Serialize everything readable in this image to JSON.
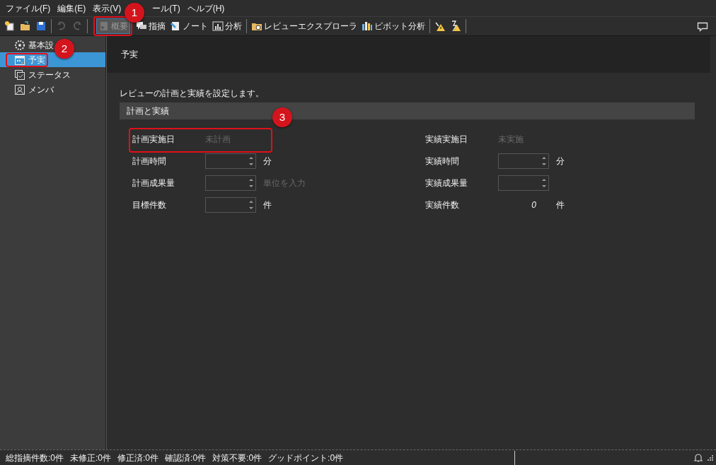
{
  "menu": [
    "ファイル(F)",
    "編集(E)",
    "表示(V)",
    "ール(T)",
    "ヘルプ(H)"
  ],
  "toolbar": [
    {
      "kind": "new",
      "disabled": false
    },
    {
      "kind": "open",
      "disabled": false
    },
    {
      "kind": "save",
      "disabled": false
    },
    {
      "kind": "sep"
    },
    {
      "kind": "undo",
      "disabled": true
    },
    {
      "kind": "redo",
      "disabled": true
    },
    {
      "kind": "sep"
    },
    {
      "kind": "overview",
      "label": "概要",
      "disabled": true
    },
    {
      "kind": "comment",
      "label": "指摘",
      "disabled": false
    },
    {
      "kind": "note",
      "label": "ノート",
      "disabled": false
    },
    {
      "kind": "chart",
      "label": "分析",
      "disabled": false
    },
    {
      "kind": "sep"
    },
    {
      "kind": "explorer",
      "label": "レビューエクスプローラ",
      "disabled": false
    },
    {
      "kind": "pivot",
      "label": "ピボット分析",
      "disabled": false
    },
    {
      "kind": "sep"
    },
    {
      "kind": "warn",
      "disabled": false
    },
    {
      "kind": "warn2",
      "disabled": false
    },
    {
      "kind": "sep"
    }
  ],
  "sidebar": {
    "items": [
      {
        "kind": "gear",
        "label": "基本設",
        "selected": false
      },
      {
        "kind": "calendar",
        "label": "予実",
        "selected": true
      },
      {
        "kind": "status",
        "label": "ステータス",
        "selected": false
      },
      {
        "kind": "member",
        "label": "メンバ",
        "selected": false
      }
    ]
  },
  "page_title": "予実",
  "description": "レビューの計画と実績を設定します。",
  "section": {
    "title": "計画と実績",
    "left": [
      {
        "kind": "text",
        "label": "計画実施日",
        "value": "未計画"
      },
      {
        "kind": "spin",
        "label": "計画時間",
        "unit": "分",
        "unit_dim": false
      },
      {
        "kind": "spin",
        "label": "計画成果量",
        "unit": "単位を入力",
        "unit_dim": true
      },
      {
        "kind": "spin",
        "label": "目標件数",
        "unit": "件",
        "unit_dim": false
      }
    ],
    "right": [
      {
        "kind": "text",
        "label": "実績実施日",
        "value": "未実施"
      },
      {
        "kind": "spin",
        "label": "実績時間",
        "unit": "分",
        "unit_dim": false
      },
      {
        "kind": "spin",
        "label": "実績成果量"
      },
      {
        "kind": "count",
        "label": "実績件数",
        "value": "0",
        "unit": "件"
      }
    ]
  },
  "status_bar": [
    "総指摘件数:0件",
    "未修正:0件",
    "修正済:0件",
    "確認済:0件",
    "対策不要:0件",
    "グッドポイント:0件"
  ],
  "annotations": [
    "1",
    "2",
    "3"
  ]
}
